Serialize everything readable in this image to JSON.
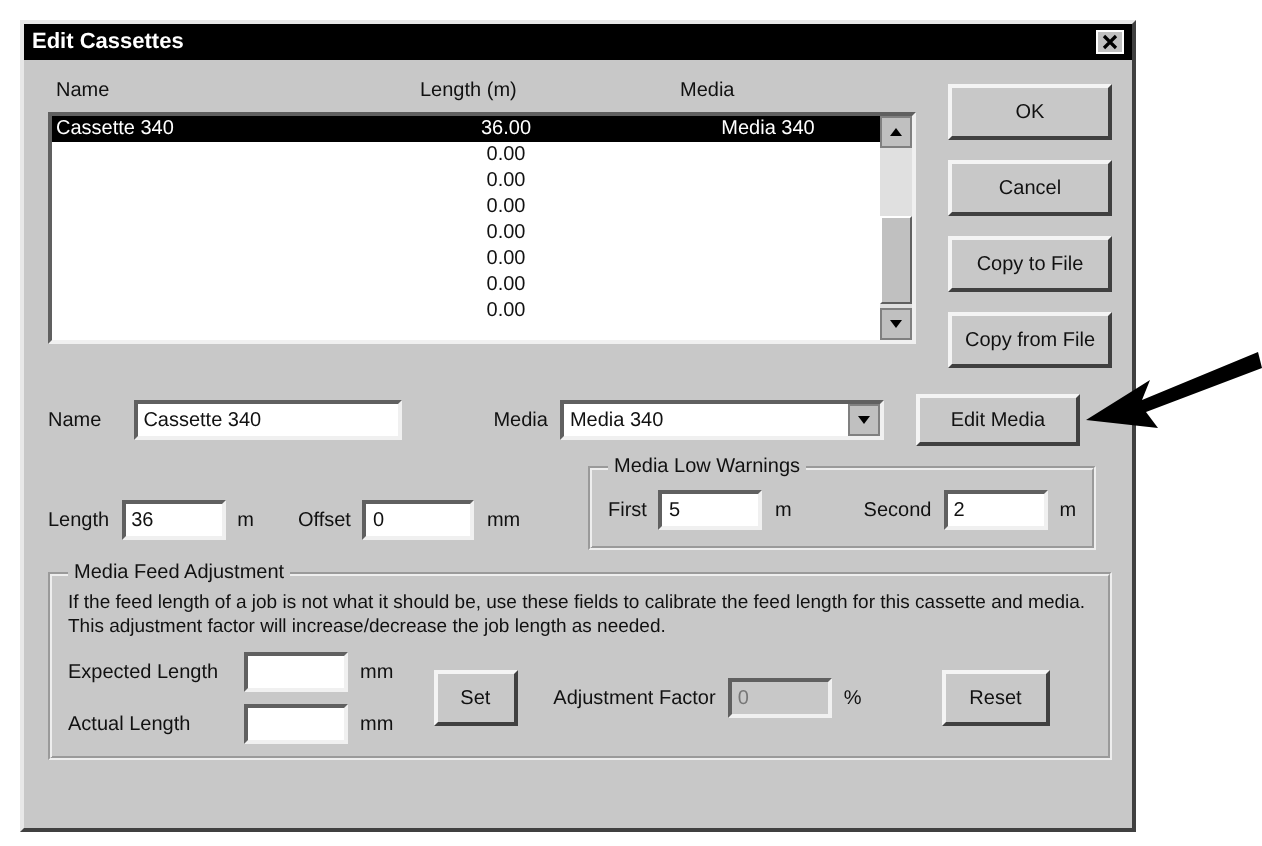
{
  "window": {
    "title": "Edit Cassettes"
  },
  "list": {
    "columns": [
      "Name",
      "Length (m)",
      "Media"
    ],
    "rows": [
      {
        "name": "Cassette 340",
        "length": "36.00",
        "media": "Media 340",
        "selected": true
      },
      {
        "length": "0.00",
        "selected": false
      },
      {
        "length": "0.00",
        "selected": false
      },
      {
        "length": "0.00",
        "selected": false
      },
      {
        "length": "0.00",
        "selected": false
      },
      {
        "length": "0.00",
        "selected": false
      },
      {
        "length": "0.00",
        "selected": false
      },
      {
        "length": "0.00",
        "selected": false
      }
    ]
  },
  "side_buttons": [
    "OK",
    "Cancel",
    "Copy to File",
    "Copy from File"
  ],
  "name_field": {
    "label": "Name",
    "value": "Cassette 340"
  },
  "media_field": {
    "label": "Media",
    "value": "Media 340"
  },
  "edit_media_button": "Edit Media",
  "length_field": {
    "label": "Length",
    "value": "36",
    "unit": "m"
  },
  "offset_field": {
    "label": "Offset",
    "value": "0",
    "unit": "mm"
  },
  "low_warnings": {
    "title": "Media Low Warnings",
    "first": {
      "label": "First",
      "value": "5",
      "unit": "m"
    },
    "second": {
      "label": "Second",
      "value": "2",
      "unit": "m"
    }
  },
  "feed_adjustment": {
    "title": "Media Feed Adjustment",
    "description": "If the feed length of a job is not what it should be, use these fields to calibrate the feed length for this cassette and media. This adjustment factor will increase/decrease the job length as needed.",
    "expected": {
      "label": "Expected Length",
      "unit": "mm"
    },
    "actual": {
      "label": "Actual Length",
      "unit": "mm"
    },
    "set_button": "Set",
    "factor": {
      "label": "Adjustment Factor",
      "value": "0",
      "unit": "%",
      "disabled": true
    },
    "reset_button": "Reset"
  }
}
